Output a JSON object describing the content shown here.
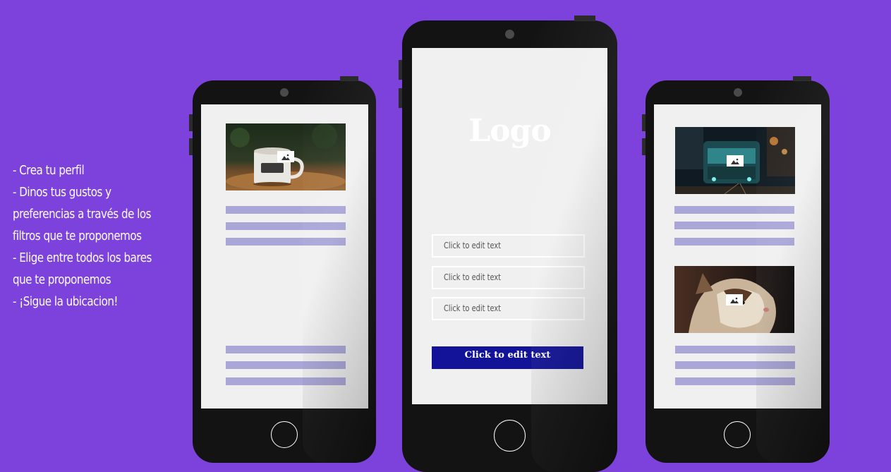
{
  "features": {
    "line1": "- Crea tu perfil",
    "line2": "- Dinos tus gustos y preferencias a través de los filtros que te proponemos",
    "line3": "- Elige entre todos los bares que te proponemos",
    "line4": "- ¡Sigue la ubicacion!"
  },
  "center_phone": {
    "logo": "Logo",
    "fields": [
      "Click to edit text",
      "Click to edit text",
      "Click to edit text"
    ],
    "button_label": "Click to edit text"
  },
  "left_phone": {
    "photo_icon": "image-placeholder-icon",
    "photo_subject": "coffee mug",
    "text_bars_top": 3,
    "text_bars_bottom": 3
  },
  "right_phone": {
    "photos": [
      "tram at night",
      "cat"
    ],
    "photo_icon": "image-placeholder-icon"
  },
  "colors": {
    "background": "#7d42dc",
    "phone_body": "#131313",
    "screen": "#f0f0f0",
    "text_bar": "#aaa6d8",
    "button": "#13139a"
  }
}
